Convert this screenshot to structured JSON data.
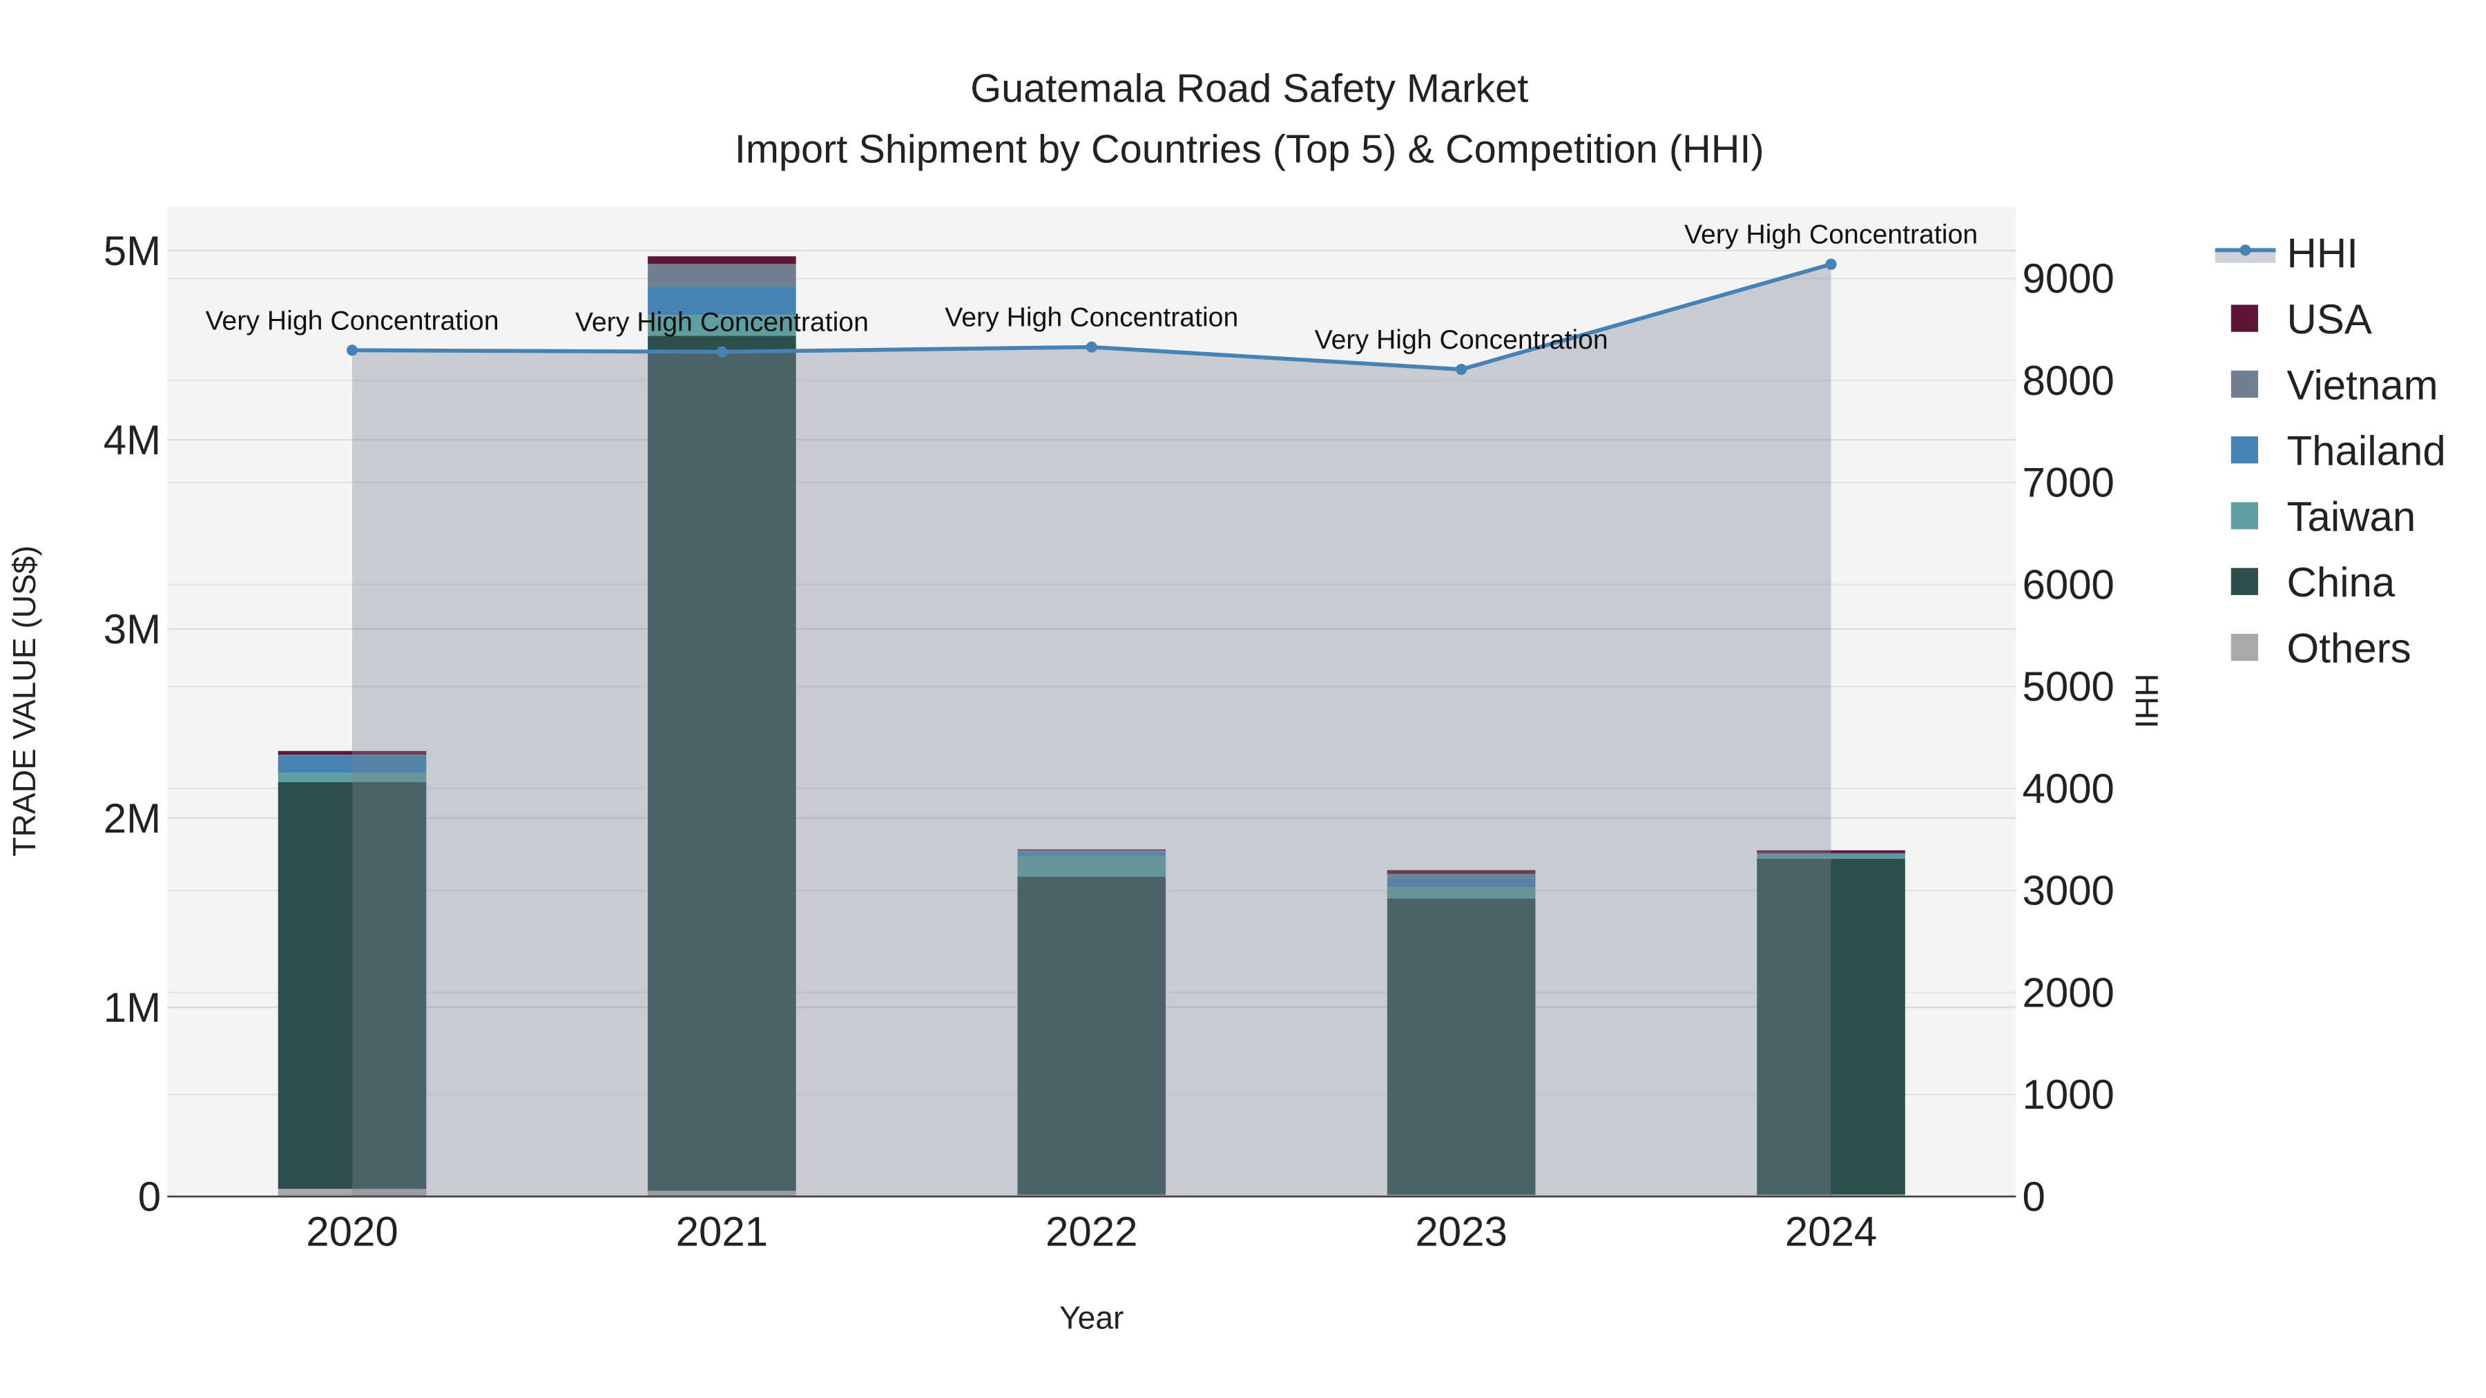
{
  "chart_data": {
    "type": "bar",
    "title": "Guatemala Road Safety Market",
    "subtitle": "Import Shipment by Countries (Top 5) & Competition (HHI)",
    "xlabel": "Year",
    "ylabel": "TRADE VALUE (US$)",
    "y2label": "HHI",
    "categories": [
      "2020",
      "2021",
      "2022",
      "2023",
      "2024"
    ],
    "ylim": [
      0,
      5230000
    ],
    "y2lim": [
      0,
      9700
    ],
    "yticks": [
      0,
      1000000,
      2000000,
      3000000,
      4000000,
      5000000
    ],
    "ytick_labels": [
      "0",
      "1M",
      "2M",
      "3M",
      "4M",
      "5M"
    ],
    "y2ticks": [
      0,
      1000,
      2000,
      3000,
      4000,
      5000,
      6000,
      7000,
      8000,
      9000
    ],
    "y2tick_labels": [
      "0",
      "1000",
      "2000",
      "3000",
      "4000",
      "5000",
      "6000",
      "7000",
      "8000",
      "9000"
    ],
    "series": [
      {
        "name": "Others",
        "color": "#A9A9A9",
        "values": [
          40000,
          30000,
          10000,
          10000,
          10000
        ]
      },
      {
        "name": "China",
        "color": "#2F4F4F",
        "values": [
          2150000,
          4520000,
          1680000,
          1565000,
          1775000
        ]
      },
      {
        "name": "Taiwan",
        "color": "#5F9EA0",
        "values": [
          50000,
          110000,
          110000,
          60000,
          20000
        ]
      },
      {
        "name": "Thailand",
        "color": "#4682B4",
        "values": [
          90000,
          150000,
          20000,
          50000,
          5000
        ]
      },
      {
        "name": "Vietnam",
        "color": "#708090",
        "values": [
          5000,
          120000,
          10000,
          20000,
          5000
        ]
      },
      {
        "name": "USA",
        "color": "#5E1638",
        "values": [
          20000,
          40000,
          5000,
          20000,
          15000
        ]
      }
    ],
    "hhi": {
      "name": "HHI",
      "color": "#4682B4",
      "values": [
        8297,
        8281,
        8328,
        8109,
        9140
      ],
      "labels": [
        "Very High Concentration",
        "Very High Concentration",
        "Very High Concentration",
        "Very High Concentration",
        "Very High Concentration"
      ]
    },
    "legend": [
      "HHI",
      "USA",
      "Vietnam",
      "Thailand",
      "Taiwan",
      "China",
      "Others"
    ],
    "legend_position": "right",
    "grid": true
  }
}
